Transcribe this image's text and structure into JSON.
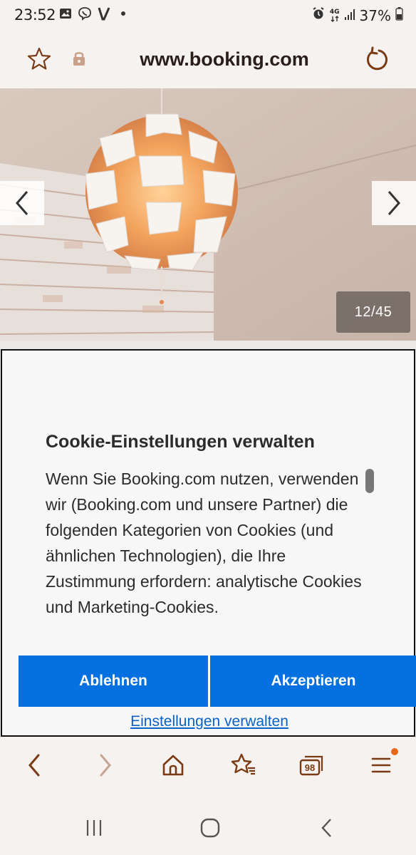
{
  "status_bar": {
    "time": "23:52",
    "battery": "37%",
    "network": "4G",
    "left_icons": [
      "gallery-icon",
      "viber-icon",
      "v-app-icon",
      "dot-icon"
    ],
    "right_icons": [
      "alarm-icon",
      "network-4g-icon",
      "signal-icon",
      "battery-icon"
    ]
  },
  "address_bar": {
    "url": "www.booking.com",
    "icons": [
      "star-icon",
      "lock-icon",
      "reload-icon"
    ]
  },
  "gallery": {
    "counter": "12/45",
    "prev_icon": "chevron-left-icon",
    "next_icon": "chevron-right-icon"
  },
  "cookie_dialog": {
    "title": "Cookie-Einstellungen verwalten",
    "body": "Wenn Sie Booking.com nutzen, verwenden wir (Booking.com und unsere Partner) die folgenden Kategorien von Cookies (und ähnlichen Technologien), die Ihre Zustimmung erfordern: analytische Cookies und Marketing-Cookies.",
    "reject_label": "Ablehnen",
    "accept_label": "Akzeptieren",
    "settings_label": "Einstellungen verwalten"
  },
  "toolbar": {
    "tab_count": "98",
    "icons": [
      "back-icon",
      "forward-icon",
      "home-icon",
      "bookmarks-icon",
      "tabs-icon",
      "menu-icon"
    ]
  },
  "android_nav": {
    "icons": [
      "recents-icon",
      "home-circle-icon",
      "back-chevron-icon"
    ]
  },
  "colors": {
    "accent": "#0571e0",
    "link": "#0a63c6",
    "browser_icon": "#7a3a14",
    "background": "#f6f2f0"
  }
}
